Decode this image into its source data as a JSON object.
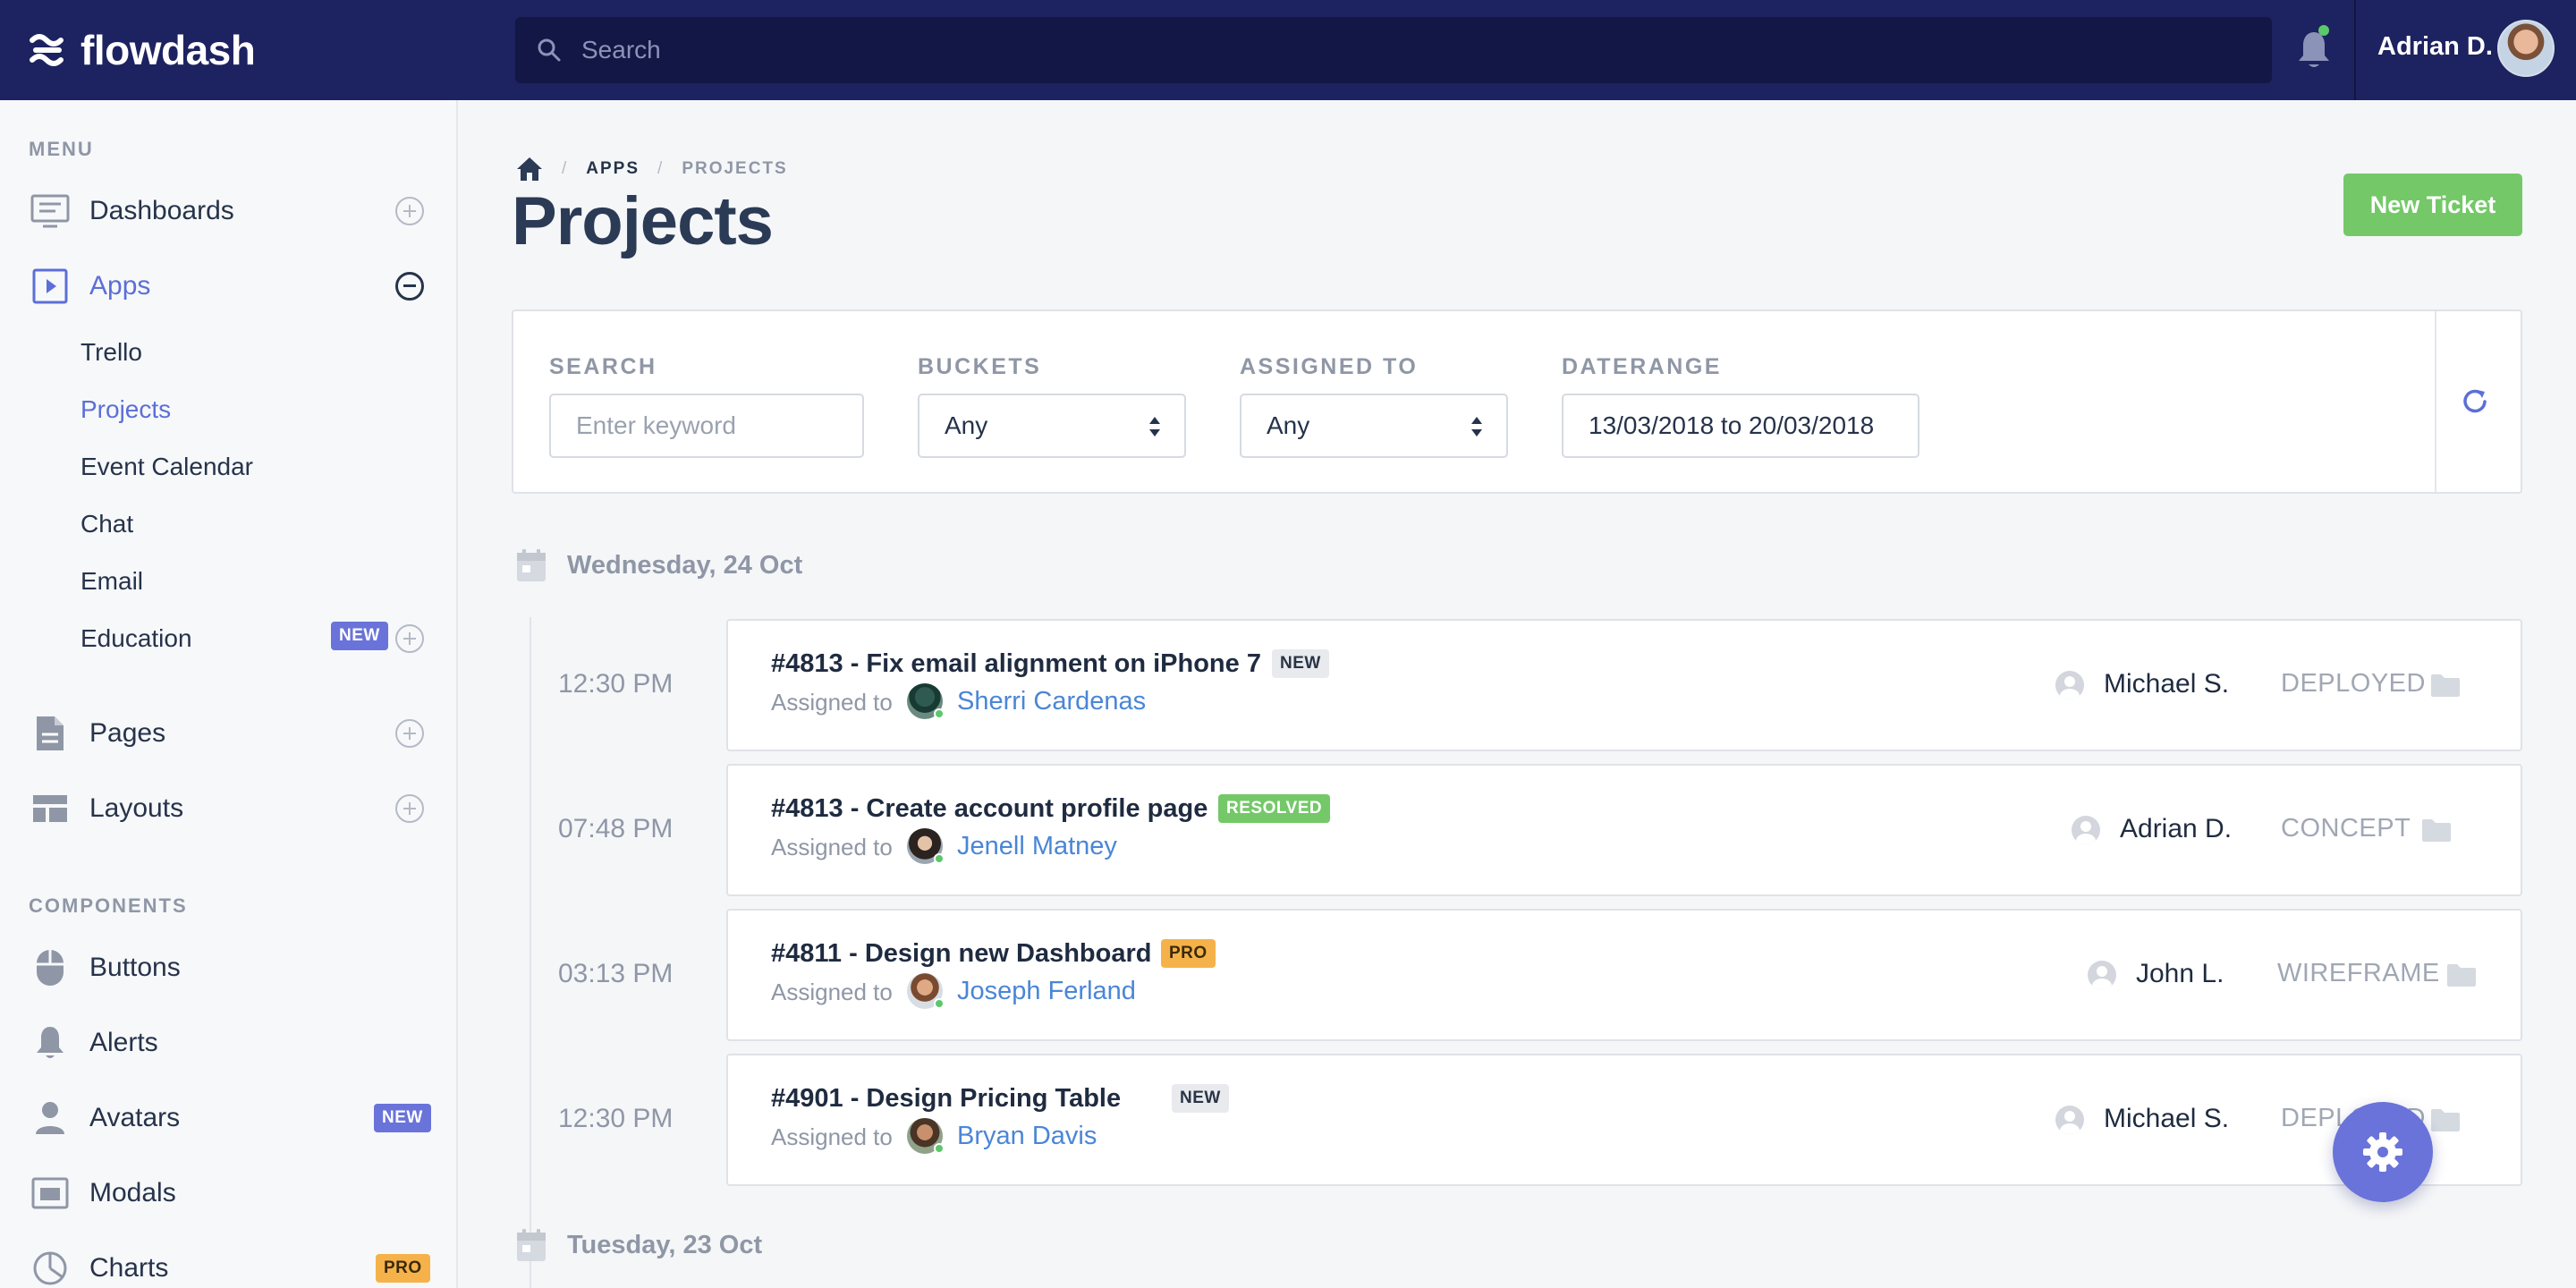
{
  "app": {
    "brand": "flowdash"
  },
  "topbar": {
    "search_placeholder": "Search",
    "user_name": "Adrian D.",
    "notification_dot_color": "#5cc76b"
  },
  "sidebar": {
    "menu_label": "MENU",
    "components_label": "COMPONENTS",
    "items": [
      {
        "label": "Dashboards",
        "icon": "dashboard-icon",
        "control": "plus"
      },
      {
        "label": "Apps",
        "icon": "apps-icon",
        "control": "minus",
        "active": true
      },
      {
        "label": "Pages",
        "icon": "pages-icon",
        "control": "plus"
      },
      {
        "label": "Layouts",
        "icon": "layouts-icon",
        "control": "plus"
      }
    ],
    "apps_sub": [
      {
        "label": "Trello"
      },
      {
        "label": "Projects",
        "active": true
      },
      {
        "label": "Event Calendar"
      },
      {
        "label": "Chat"
      },
      {
        "label": "Email"
      },
      {
        "label": "Education",
        "badge": "NEW"
      }
    ],
    "components": [
      {
        "label": "Buttons",
        "icon": "mouse-icon"
      },
      {
        "label": "Alerts",
        "icon": "bell-icon"
      },
      {
        "label": "Avatars",
        "icon": "person-icon",
        "badge": "NEW"
      },
      {
        "label": "Modals",
        "icon": "modal-icon"
      },
      {
        "label": "Charts",
        "icon": "pie-chart-icon",
        "badge": "PRO"
      }
    ]
  },
  "main": {
    "breadcrumb": {
      "apps": "APPS",
      "projects": "PROJECTS"
    },
    "title": "Projects",
    "new_ticket_label": "New Ticket",
    "filters": {
      "search_label": "SEARCH",
      "search_placeholder": "Enter keyword",
      "buckets_label": "BUCKETS",
      "buckets_value": "Any",
      "assigned_label": "ASSIGNED TO",
      "assigned_value": "Any",
      "daterange_label": "DATERANGE",
      "daterange_value": "13/03/2018 to 20/03/2018"
    },
    "days": [
      {
        "label": "Wednesday, 24 Oct"
      },
      {
        "label": "Tuesday, 23 Oct"
      }
    ],
    "tickets": [
      {
        "time": "12:30 PM",
        "title": "#4813 - Fix email alignment on iPhone 7",
        "badge": "NEW",
        "badge_type": "new",
        "assigned_prefix": "Assigned to",
        "assignee": "Sherri Cardenas",
        "owner": "Michael S.",
        "status": "DEPLOYED"
      },
      {
        "time": "07:48 PM",
        "title": "#4813 - Create account profile page",
        "badge": "RESOLVED",
        "badge_type": "resolved",
        "assigned_prefix": "Assigned to",
        "assignee": "Jenell Matney",
        "owner": "Adrian D.",
        "status": "CONCEPT"
      },
      {
        "time": "03:13 PM",
        "title": "#4811 - Design new Dashboard",
        "badge": "PRO",
        "badge_type": "pro",
        "assigned_prefix": "Assigned to",
        "assignee": "Joseph Ferland",
        "owner": "John L.",
        "status": "WIREFRAME"
      },
      {
        "time": "12:30 PM",
        "title": "#4901 - Design Pricing Table",
        "badge": "NEW",
        "badge_type": "new",
        "assigned_prefix": "Assigned to",
        "assignee": "Bryan Davis",
        "owner": "Michael S.",
        "status": "DEPLOYED"
      }
    ]
  },
  "colors": {
    "topbar": "#1d2260",
    "accent": "#5c6fd6",
    "success": "#74c868",
    "warning": "#f5b24a",
    "link": "#4a86d6"
  }
}
